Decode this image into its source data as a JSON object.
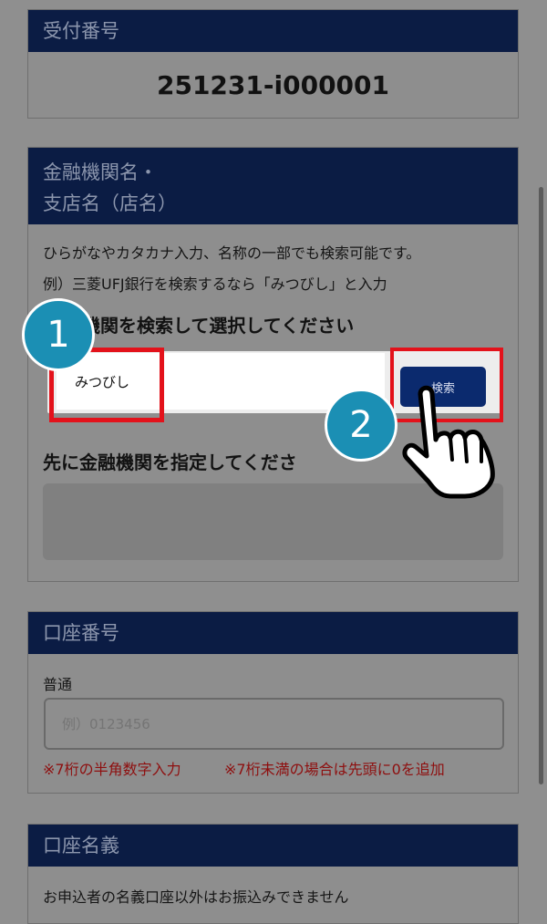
{
  "receipt": {
    "header": "受付番号",
    "value": "251231-i000001"
  },
  "bank": {
    "header_line1": "金融機関名・",
    "header_line2": "支店名（店名）",
    "note1": "ひらがなやカタカナ入力、名称の一部でも検索可能です。",
    "note2": "例）三菱UFJ銀行を検索するなら「みつびし」と入力",
    "select_label": "機関を検索して選択してください",
    "search_value": "みつびし",
    "search_button": "検索",
    "branch_label": "先に金融機関を指定してくださ"
  },
  "steps": {
    "one": "1",
    "two": "2"
  },
  "account": {
    "header": "口座番号",
    "type_label": "普通",
    "placeholder": "例）0123456",
    "warn1": "※7桁の半角数字入力",
    "warn2": "※7桁未満の場合は先頭に0を追加"
  },
  "holder": {
    "header": "口座名義",
    "note": "お申込者の名義口座以外はお振込みできません"
  },
  "colors": {
    "header_bg": "#0b1c44",
    "highlight": "#e3121b",
    "step_circle": "#1b8fb4"
  },
  "icons": {
    "pointer": "hand-pointer-icon"
  }
}
